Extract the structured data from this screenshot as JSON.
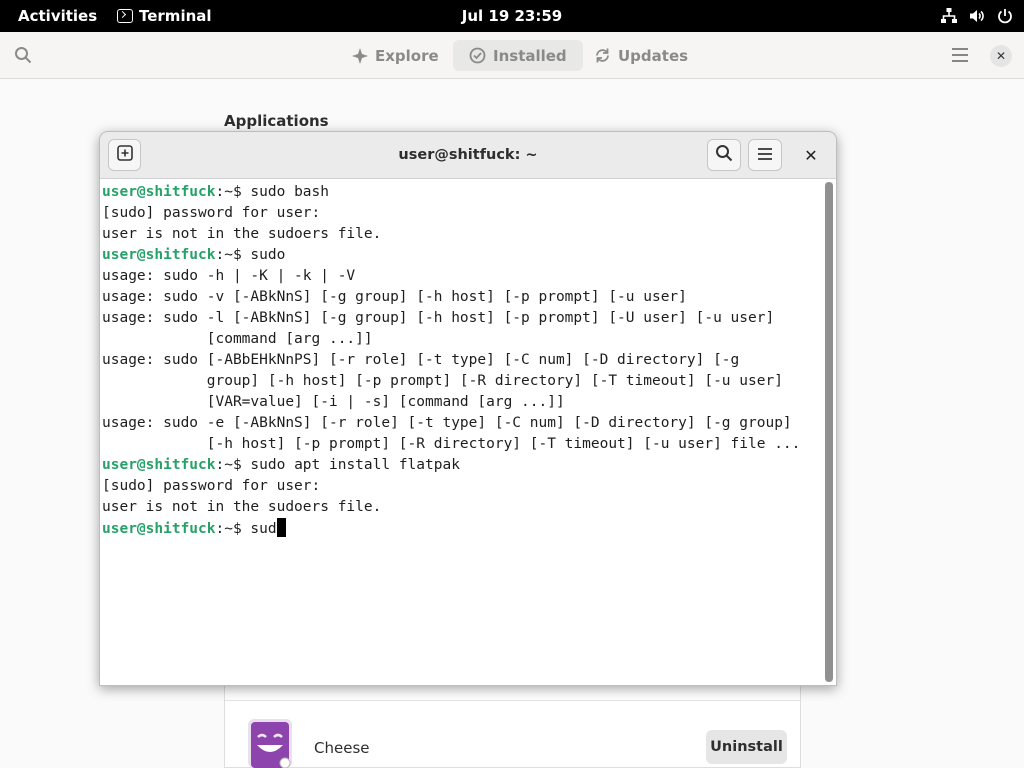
{
  "topbar": {
    "activities": "Activities",
    "app_name": "Terminal",
    "clock": "Jul 19  23:59"
  },
  "software": {
    "tabs": [
      {
        "label": "Explore",
        "icon": "explore-icon"
      },
      {
        "label": "Installed",
        "icon": "installed-check-icon",
        "active": true
      },
      {
        "label": "Updates",
        "icon": "updates-icon"
      }
    ],
    "section_heading": "Applications",
    "apps": [
      {
        "name": "Cheese",
        "action": "Uninstall"
      }
    ]
  },
  "terminal": {
    "title": "user@shitfuck: ~",
    "prompt_user": "user@shitfuck",
    "prompt_suffix": ":~$ ",
    "lines": [
      {
        "type": "prompt",
        "cmd": "sudo bash"
      },
      {
        "type": "output",
        "text": "[sudo] password for user:"
      },
      {
        "type": "output",
        "text": "user is not in the sudoers file."
      },
      {
        "type": "prompt",
        "cmd": "sudo"
      },
      {
        "type": "output",
        "text": "usage: sudo -h | -K | -k | -V"
      },
      {
        "type": "output",
        "text": "usage: sudo -v [-ABkNnS] [-g group] [-h host] [-p prompt] [-u user]"
      },
      {
        "type": "output",
        "text": "usage: sudo -l [-ABkNnS] [-g group] [-h host] [-p prompt] [-U user] [-u user]"
      },
      {
        "type": "output",
        "text": "            [command [arg ...]]"
      },
      {
        "type": "output",
        "text": "usage: sudo [-ABbEHkNnPS] [-r role] [-t type] [-C num] [-D directory] [-g"
      },
      {
        "type": "output",
        "text": "            group] [-h host] [-p prompt] [-R directory] [-T timeout] [-u user]"
      },
      {
        "type": "output",
        "text": "            [VAR=value] [-i | -s] [command [arg ...]]"
      },
      {
        "type": "output",
        "text": "usage: sudo -e [-ABkNnS] [-r role] [-t type] [-C num] [-D directory] [-g group]"
      },
      {
        "type": "output",
        "text": "            [-h host] [-p prompt] [-R directory] [-T timeout] [-u user] file ..."
      },
      {
        "type": "prompt",
        "cmd": "sudo apt install flatpak"
      },
      {
        "type": "output",
        "text": "[sudo] password for user:"
      },
      {
        "type": "output",
        "text": "user is not in the sudoers file."
      },
      {
        "type": "prompt",
        "cmd": "sud",
        "cursor": true
      }
    ]
  },
  "colors": {
    "prompt_green": "#26a269",
    "topbar_bg": "#000000",
    "cheese_purple": "#8e44ad"
  }
}
